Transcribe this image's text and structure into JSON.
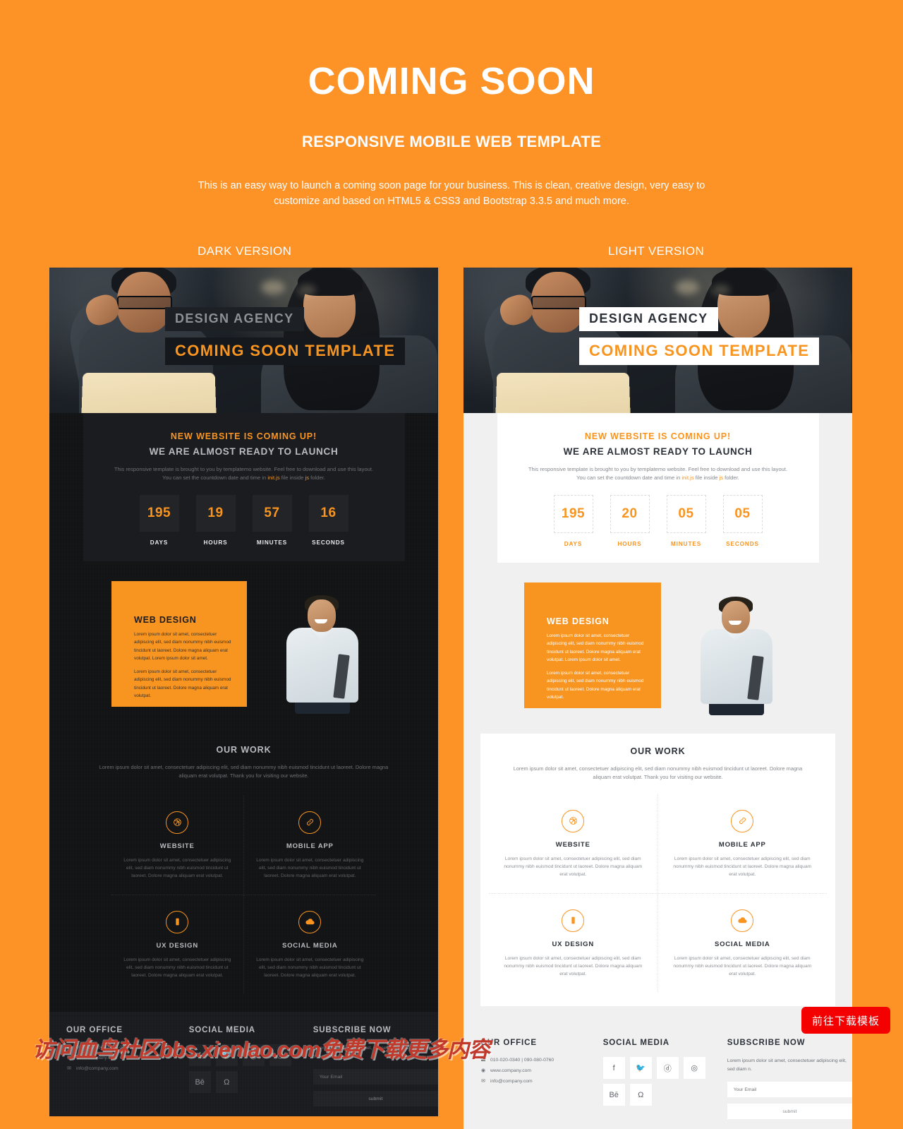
{
  "header": {
    "title": "COMING SOON",
    "subtitle": "RESPONSIVE MOBILE WEB TEMPLATE",
    "description": "This is an easy way to launch a coming soon page for your business. This is clean, creative design, very easy to customize and based on HTML5 & CSS3 and Bootstrap 3.3.5 and much more."
  },
  "labels": {
    "dark": "DARK VERSION",
    "light": "LIGHT VERSION"
  },
  "colors": {
    "background_orange": "#fd9226",
    "accent_orange": "#f89420",
    "dark_bg": "#131416",
    "dark_panel": "#1b1c1f",
    "light_bg": "#f0f0f0",
    "download_red": "#f40000"
  },
  "hero": {
    "agency": "DESIGN AGENCY",
    "tagline": "COMING SOON TEMPLATE"
  },
  "countdown": {
    "heading": "NEW WEBSITE IS COMING UP!",
    "subheading": "WE ARE ALMOST READY TO LAUNCH",
    "desc_before": "This responsive template is brought to you by templatemo website. Feel free to download and use this layout. You can set the countdown date and time in ",
    "link1": "init.js",
    "desc_mid": " file inside ",
    "link2": "js",
    "desc_after": " folder.",
    "units": [
      "DAYS",
      "HOURS",
      "MINUTES",
      "SECONDS"
    ],
    "dark_values": [
      "195",
      "19",
      "57",
      "16"
    ],
    "light_values": [
      "195",
      "20",
      "05",
      "05"
    ]
  },
  "webdesign": {
    "title": "WEB DESIGN",
    "p1": "Lorem ipsum dolor sit amet, consectetuer adipiscing elit, sed diam nonummy nibh euismod tincidunt ut laoreet. Dolore magna aliquam erat volutpat. Lorem ipsum dolor sit amet.",
    "p2": "Lorem ipsum dolor sit amet, consectetuer adipiscing elit, sed diam nonummy nibh euismod tincidunt ut laoreet. Dolore magna aliquam erat volutpat."
  },
  "ourwork": {
    "title": "OUR WORK",
    "description": "Lorem ipsum dolor sit amet, consectetuer adipiscing elit, sed diam nonummy nibh euismod tincidunt ut laoreet. Dolore magna aliquam erat volutpat. Thank you for visiting our website.",
    "items": [
      {
        "icon": "dribbble-icon",
        "name": "WEBSITE",
        "text": "Lorem ipsum dolor sit amet, consectetuer adipiscing elit, sed diam nonummy nibh euismod tincidunt ut laoreet. Dolore magna aliquam erat volutpat."
      },
      {
        "icon": "link-icon",
        "name": "MOBILE APP",
        "text": "Lorem ipsum dolor sit amet, consectetuer adipiscing elit, sed diam nonummy nibh euismod tincidunt ut laoreet. Dolore magna aliquam erat volutpat."
      },
      {
        "icon": "mobile-icon",
        "name": "UX DESIGN",
        "text": "Lorem ipsum dolor sit amet, consectetuer adipiscing elit, sed diam nonummy nibh euismod tincidunt ut laoreet. Dolore magna aliquam erat volutpat."
      },
      {
        "icon": "cloud-icon",
        "name": "SOCIAL MEDIA",
        "text": "Lorem ipsum dolor sit amet, consectetuer adipiscing elit, sed diam nonummy nibh euismod tincidunt ut laoreet. Dolore magna aliquam erat volutpat."
      }
    ]
  },
  "footer": {
    "office_title": "OUR OFFICE",
    "phone": "010-020-0340 | 090-080-0760",
    "website": "www.company.com",
    "email": "info@company.com",
    "social_title": "SOCIAL MEDIA",
    "social": [
      "f",
      "🐦",
      "ⓓ",
      "◎",
      "Bē",
      "Ω"
    ],
    "social_names": [
      "facebook-icon",
      "twitter-icon",
      "dribbble-icon",
      "instagram-icon",
      "behance-icon",
      "soundcloud-icon"
    ],
    "subscribe_title": "SUBSCRIBE NOW",
    "subscribe_desc": "Lorem ipsum dolor sit amet, consectetuer adipiscing elit, sed diam n.",
    "email_placeholder": "Your Email",
    "submit_label": "submit"
  },
  "download_button": {
    "label": "前往下载模板"
  },
  "watermark": {
    "text": "访问血鸟社区bbs.xienlao.com免费下载更多内容"
  }
}
